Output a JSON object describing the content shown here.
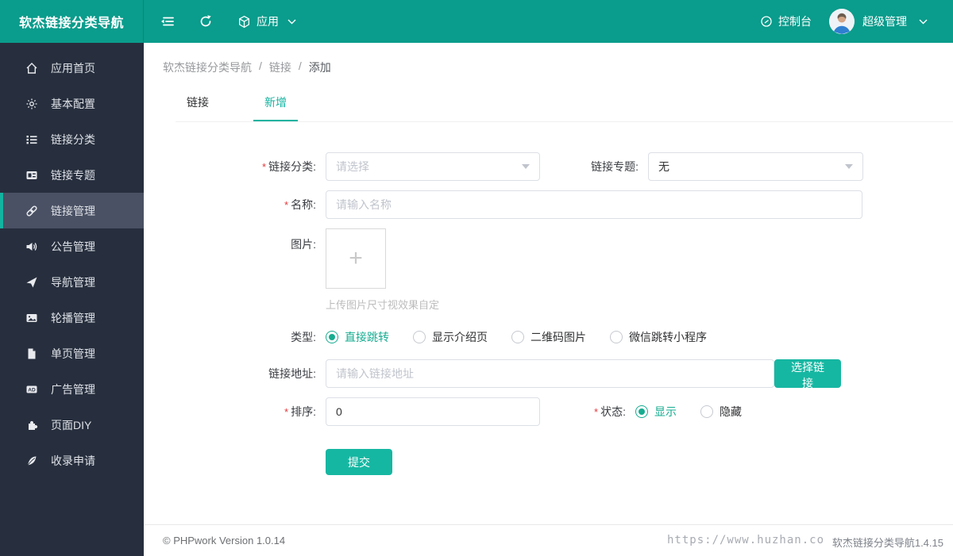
{
  "app": {
    "title": "软杰链接分类导航"
  },
  "header": {
    "app_menu_label": "应用",
    "console_label": "控制台",
    "user_label": "超级管理"
  },
  "sidebar": {
    "items": [
      {
        "label": "应用首页",
        "icon": "home-icon",
        "active": false
      },
      {
        "label": "基本配置",
        "icon": "gear-icon",
        "active": false
      },
      {
        "label": "链接分类",
        "icon": "list-icon",
        "active": false
      },
      {
        "label": "链接专题",
        "icon": "card-icon",
        "active": false
      },
      {
        "label": "链接管理",
        "icon": "link-icon",
        "active": true
      },
      {
        "label": "公告管理",
        "icon": "speaker-icon",
        "active": false
      },
      {
        "label": "导航管理",
        "icon": "send-icon",
        "active": false
      },
      {
        "label": "轮播管理",
        "icon": "image-icon",
        "active": false
      },
      {
        "label": "单页管理",
        "icon": "file-icon",
        "active": false
      },
      {
        "label": "广告管理",
        "icon": "ad-icon",
        "active": false
      },
      {
        "label": "页面DIY",
        "icon": "puzzle-icon",
        "active": false
      },
      {
        "label": "收录申请",
        "icon": "feather-icon",
        "active": false
      }
    ]
  },
  "breadcrumb": {
    "separator": "/",
    "items": [
      "软杰链接分类导航",
      "链接",
      "添加"
    ]
  },
  "tabs": [
    {
      "label": "链接",
      "active": false
    },
    {
      "label": "新增",
      "active": true
    }
  ],
  "form": {
    "required_mark": "*",
    "category": {
      "label": "链接分类:",
      "placeholder": "请选择"
    },
    "topic": {
      "label": "链接专题:",
      "value": "无"
    },
    "name": {
      "label": "名称:",
      "placeholder": "请输入名称"
    },
    "image": {
      "label": "图片:",
      "plus": "+",
      "hint": "上传图片尺寸视效果自定"
    },
    "type": {
      "label": "类型:",
      "options": [
        {
          "label": "直接跳转",
          "selected": true
        },
        {
          "label": "显示介绍页",
          "selected": false
        },
        {
          "label": "二维码图片",
          "selected": false
        },
        {
          "label": "微信跳转小程序",
          "selected": false
        }
      ]
    },
    "url": {
      "label": "链接地址:",
      "placeholder": "请输入链接地址",
      "button_label": "选择链接"
    },
    "sort": {
      "label": "排序:",
      "value": "0"
    },
    "status": {
      "label": "状态:",
      "options": [
        {
          "label": "显示",
          "selected": true
        },
        {
          "label": "隐藏",
          "selected": false
        }
      ]
    },
    "submit_label": "提交"
  },
  "footer": {
    "copyright": "© PHPwork Version 1.0.14",
    "watermark_url": "https://www.huzhan.co",
    "watermark_text": "软杰链接分类导航1.4.15"
  },
  "colors": {
    "header_teal": "#0a9c8c",
    "accent_teal": "#16b7a2",
    "sidebar_bg": "#272f3e",
    "sidebar_active_bg": "#4a5164",
    "required_red": "#e4393c"
  }
}
